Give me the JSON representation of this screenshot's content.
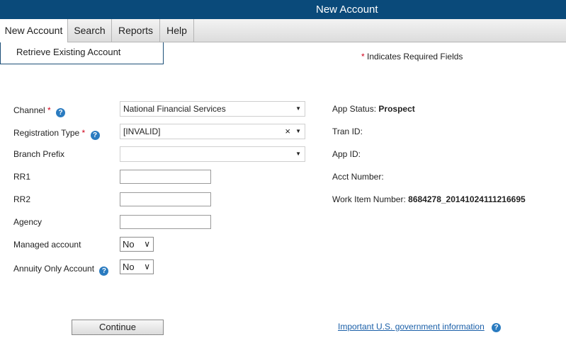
{
  "header": {
    "title": "New Account"
  },
  "menu": {
    "items": [
      {
        "label": "New Account"
      },
      {
        "label": "Search"
      },
      {
        "label": "Reports"
      },
      {
        "label": "Help"
      }
    ],
    "submenu": {
      "label": "Retrieve Existing Account"
    }
  },
  "required_note": {
    "star": "*",
    "text": " Indicates Required Fields"
  },
  "form": {
    "channel": {
      "label": "Channel",
      "value": "National Financial Services"
    },
    "registration_type": {
      "label": "Registration Type",
      "value": "[INVALID]"
    },
    "branch_prefix": {
      "label": "Branch Prefix",
      "value": ""
    },
    "rr1": {
      "label": "RR1",
      "value": ""
    },
    "rr2": {
      "label": "RR2",
      "value": ""
    },
    "agency": {
      "label": "Agency",
      "value": ""
    },
    "managed_account": {
      "label": "Managed account",
      "value": "No"
    },
    "annuity_only": {
      "label": "Annuity Only Account",
      "value": "No"
    },
    "required_star": "*"
  },
  "info": {
    "app_status_label": "App Status:",
    "app_status_value": "Prospect",
    "tran_id_label": "Tran ID:",
    "app_id_label": "App ID:",
    "acct_number_label": "Acct Number:",
    "work_item_label": "Work Item Number:",
    "work_item_value": "8684278_20141024111216695"
  },
  "actions": {
    "continue_label": "Continue",
    "gov_link_label": "Important U.S. government information"
  },
  "icons": {
    "help": "?",
    "dropdown": "▼",
    "clear": "×"
  },
  "colors": {
    "header_bg": "#0a4a7a",
    "required_star": "#d0021b",
    "link": "#1a5fa8",
    "help_icon": "#2a7bc0"
  }
}
